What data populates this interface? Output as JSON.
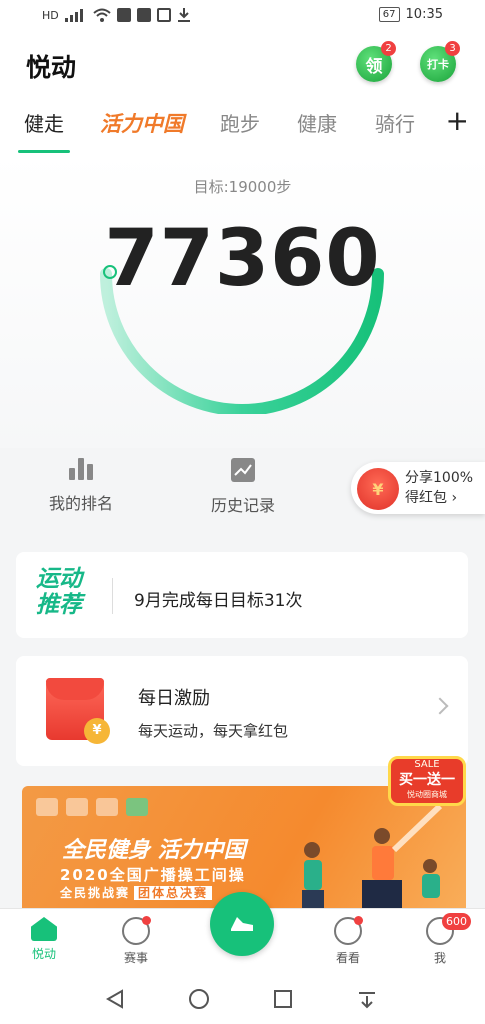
{
  "status_bar": {
    "left_icons": [
      "hd-icon",
      "signal-icon",
      "wifi-icon",
      "app-icon",
      "app-icon",
      "clean-icon",
      "download-icon"
    ],
    "hd_label": "HD",
    "battery": "67",
    "time": "10:35"
  },
  "header": {
    "title": "悦动",
    "claim_button": {
      "label": "领",
      "badge": "2"
    },
    "checkin_button": {
      "label": "打卡",
      "badge": "3"
    }
  },
  "tabs": [
    {
      "label": "健走",
      "active": true
    },
    {
      "label": "活力中国",
      "active": false,
      "special": true
    },
    {
      "label": "跑步",
      "active": false
    },
    {
      "label": "健康",
      "active": false
    },
    {
      "label": "骑行",
      "active": false
    }
  ],
  "tab_add_label": "+",
  "steps": {
    "goal": "目标:19000步",
    "count": "77360",
    "progress_fraction": 1.0
  },
  "quick_actions": {
    "ranking_label": "我的排名",
    "history_label": "历史记录"
  },
  "share": {
    "icon_glyph": "¥",
    "line1": "分享100%",
    "line2": "得红包"
  },
  "recommend": {
    "logo_line1": "运动",
    "logo_line2": "推荐",
    "text": "9月完成每日目标31次"
  },
  "daily": {
    "title": "每日激励",
    "subtitle": "每天运动，每天拿红包",
    "coin": "¥"
  },
  "banner": {
    "title": "全民健身 活力中国",
    "line2": "2020全国广播操工间操",
    "line3": "全民挑战赛",
    "line3_tag": "团体总决赛"
  },
  "sale_badge": {
    "top": "SALE",
    "main": "买一送一",
    "bottom": "悦动圈商城"
  },
  "bottom_nav": {
    "home": "悦动",
    "events": "赛事",
    "watch": "看看",
    "me": "我",
    "me_badge": "600"
  },
  "colors": {
    "accent": "#17c17a",
    "special_tab": "#f07a2a",
    "badge": "#f04040"
  }
}
